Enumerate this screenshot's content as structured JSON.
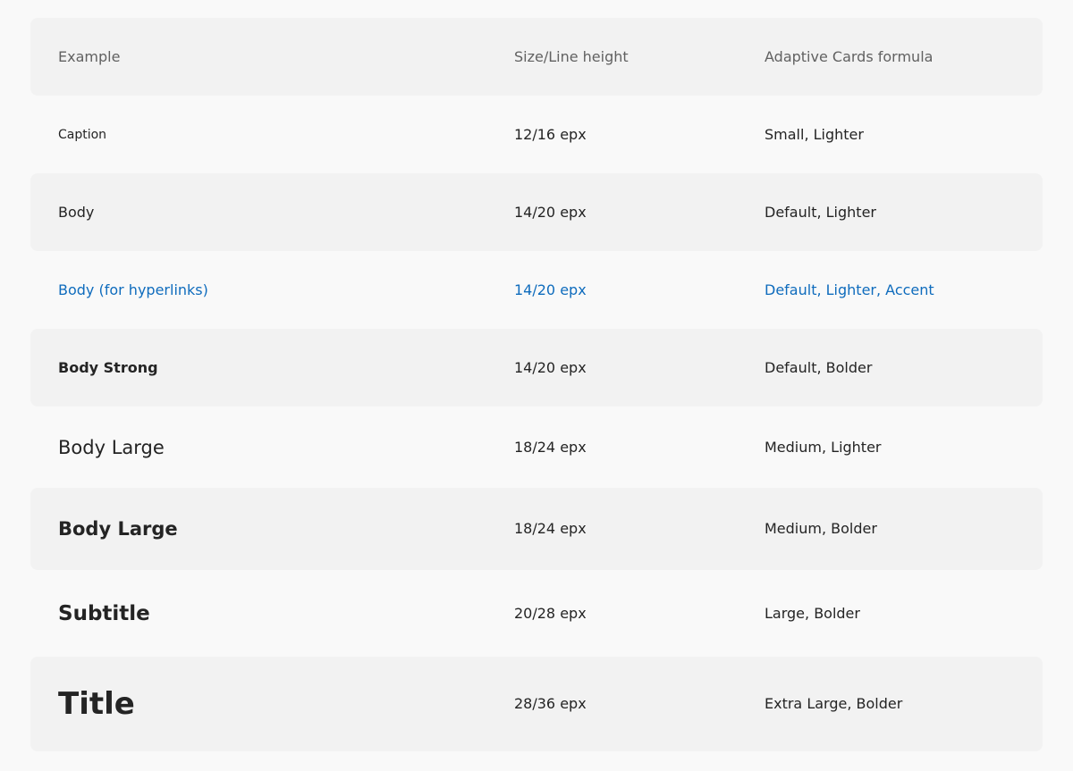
{
  "header": {
    "example": "Example",
    "size": "Size/Line height",
    "formula": "Adaptive Cards formula"
  },
  "rows": [
    {
      "example": "Caption",
      "size": "12/16 epx",
      "formula": "Small, Lighter"
    },
    {
      "example": "Body",
      "size": "14/20 epx",
      "formula": "Default, Lighter"
    },
    {
      "example": "Body (for hyperlinks)",
      "size": "14/20 epx",
      "formula": "Default, Lighter, Accent"
    },
    {
      "example": "Body Strong",
      "size": "14/20 epx",
      "formula": "Default, Bolder"
    },
    {
      "example": "Body Large",
      "size": "18/24 epx",
      "formula": "Medium, Lighter"
    },
    {
      "example": "Body Large",
      "size": "18/24 epx",
      "formula": "Medium, Bolder"
    },
    {
      "example": "Subtitle",
      "size": "20/28 epx",
      "formula": "Large, Bolder"
    },
    {
      "example": "Title",
      "size": "28/36 epx",
      "formula": "Extra Large, Bolder"
    }
  ],
  "colors": {
    "page_background": "#f9f9f9",
    "row_shade": "#f2f2f2",
    "text": "#242424",
    "header_text": "#616161",
    "accent": "#0f6cbd"
  }
}
